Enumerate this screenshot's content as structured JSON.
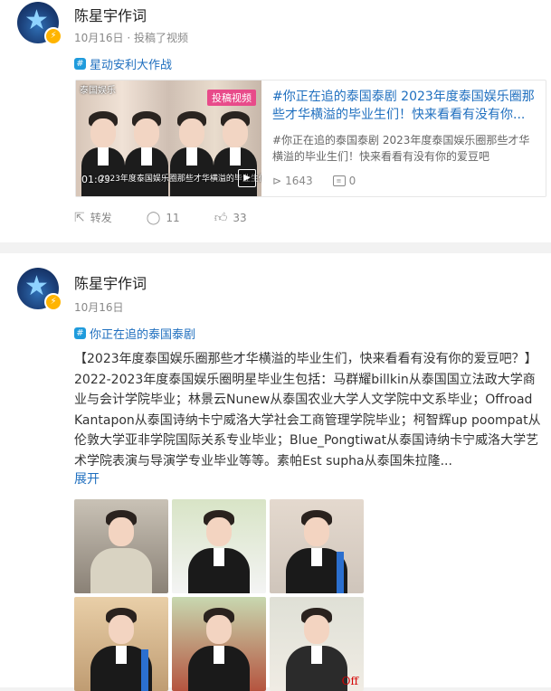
{
  "post1": {
    "author": "陈星宇作词",
    "date": "10月16日",
    "source": "投稿了视频",
    "topic": "星动安利大作战",
    "share": {
      "title": "#你正在追的泰国泰剧 2023年度泰国娱乐圈那些才华横溢的毕业生们！快来看看有没有你...",
      "desc": "#你正在追的泰国泰剧 2023年度泰国娱乐圈那些才华横溢的毕业生们！快来看看有没有你的爱豆吧",
      "views": "1643",
      "comments": "0",
      "thumb_tag": "投稿视频",
      "thumb_duration": "01:03",
      "thumb_caption": "2023年度泰国娱乐圈那些才华横溢的毕业生们",
      "thumb_brand": "泰国娱乐"
    },
    "actions": {
      "repost_label": "转发",
      "comment_count": "11",
      "like_count": "33"
    }
  },
  "post2": {
    "author": "陈星宇作词",
    "date": "10月16日",
    "topic": "你正在追的泰国泰剧",
    "text": "【2023年度泰国娱乐圈那些才华横溢的毕业生们，快来看看有没有你的爱豆吧？】2022-2023年度泰国娱乐圈明星毕业生包括：马群耀billkin从泰国国立法政大学商业与会计学院毕业；林景云Nunew从泰国农业大学人文学院中文系毕业；Offroad Kantapon从泰国诗纳卡宁威洛大学社会工商管理学院毕业；柯智辉up poompat从伦敦大学亚非学院国际关系专业毕业；Blue_Pongtiwat从泰国诗纳卡宁威洛大学艺术学院表演与导演学专业毕业等等。素帕Est supha从泰国朱拉隆...",
    "expand_label": "展开",
    "photo_logo": "Off"
  },
  "colors": {
    "link": "#1f6fbf",
    "badge": "#ffb400",
    "topic_icon": "#1f9bdc",
    "video_tag": "#e84b8a"
  },
  "icons": [
    "verified-badge-icon",
    "topic-hash-icon",
    "play-icon",
    "comment-box-icon",
    "repost-icon",
    "comment-icon",
    "like-icon"
  ]
}
